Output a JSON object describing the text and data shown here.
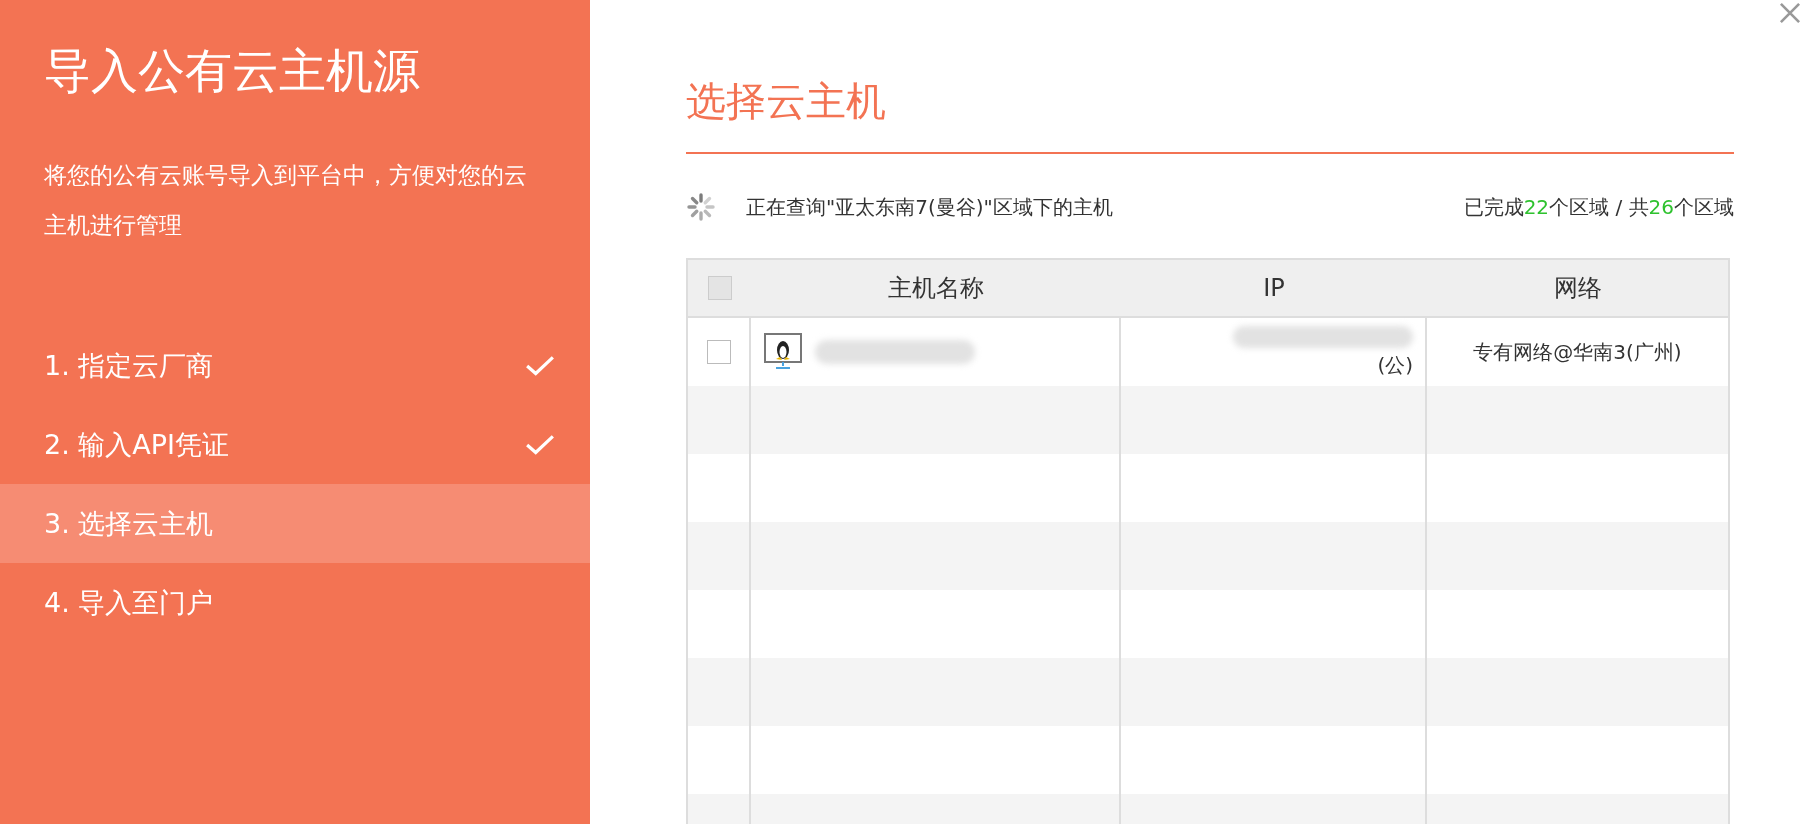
{
  "sidebar": {
    "title": "导入公有云主机源",
    "description": "将您的公有云账号导入到平台中，方便对您的云主机进行管理",
    "steps": [
      {
        "label": "1. 指定云厂商",
        "completed": true,
        "selected": false
      },
      {
        "label": "2. 输入API凭证",
        "completed": true,
        "selected": false
      },
      {
        "label": "3. 选择云主机",
        "completed": false,
        "selected": true
      },
      {
        "label": "4. 导入至门户",
        "completed": false,
        "selected": false
      }
    ]
  },
  "main": {
    "title": "选择云主机",
    "status": "正在查询\"亚太东南7(曼谷)\"区域下的主机",
    "progress": {
      "prefix": "已完成",
      "done": "22",
      "middle": "个区域 / 共",
      "total": "26",
      "suffix": "个区域"
    },
    "table": {
      "select_all": {
        "checked": false
      },
      "columns": [
        "主机名称",
        "IP",
        "网络"
      ],
      "rows": [
        {
          "checked": false,
          "ip": "(公)",
          "network": "专有网络@华南3(广州)"
        }
      ]
    }
  }
}
